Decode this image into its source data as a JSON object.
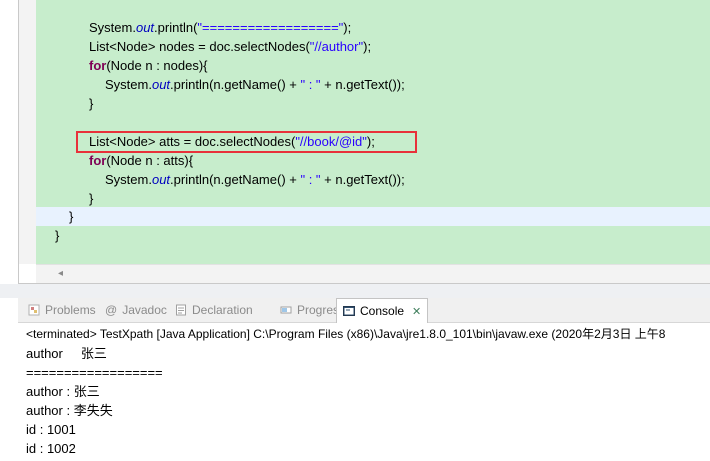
{
  "editor": {
    "lines": [
      {
        "parts": [
          {
            "t": "System."
          },
          {
            "t": "out",
            "c": "fld"
          },
          {
            "t": ".println("
          },
          {
            "t": "\"==================\"",
            "c": "str"
          },
          {
            "t": ");"
          }
        ]
      },
      {
        "parts": [
          {
            "t": "List<Node> nodes = doc.selectNodes("
          },
          {
            "t": "\"//author\"",
            "c": "str"
          },
          {
            "t": ");"
          }
        ]
      },
      {
        "parts": [
          {
            "t": "for",
            "c": "kw"
          },
          {
            "t": "(Node n : nodes){"
          }
        ]
      },
      {
        "parts": [
          {
            "t": "System."
          },
          {
            "t": "out",
            "c": "fld"
          },
          {
            "t": ".println(n.getName() + "
          },
          {
            "t": "\" : \"",
            "c": "str"
          },
          {
            "t": " + n.getText());"
          }
        ]
      },
      {
        "parts": [
          {
            "t": "}"
          }
        ]
      },
      {
        "parts": []
      },
      {
        "parts": [
          {
            "t": "List<Node> atts = doc.selectNodes("
          },
          {
            "t": "\"//book/@id\"",
            "c": "str"
          },
          {
            "t": ");"
          }
        ]
      },
      {
        "parts": [
          {
            "t": "for",
            "c": "kw"
          },
          {
            "t": "(Node n : atts){"
          }
        ]
      },
      {
        "parts": [
          {
            "t": "System."
          },
          {
            "t": "out",
            "c": "fld"
          },
          {
            "t": ".println(n.getName() + "
          },
          {
            "t": "\" : \"",
            "c": "str"
          },
          {
            "t": " + n.getText());"
          }
        ]
      },
      {
        "parts": [
          {
            "t": "}"
          }
        ]
      },
      {
        "parts": [
          {
            "t": "}"
          }
        ]
      },
      {
        "parts": [
          {
            "t": "}"
          }
        ]
      }
    ]
  },
  "views": {
    "tabs": [
      {
        "label": "Problems",
        "icon": "problems-icon",
        "active": false
      },
      {
        "label": "Javadoc",
        "icon": "at-icon",
        "active": false
      },
      {
        "label": "Declaration",
        "icon": "declaration-icon",
        "active": false
      },
      {
        "label": "Progress",
        "icon": "progress-icon",
        "active": false
      },
      {
        "label": "Console",
        "icon": "console-icon",
        "active": true
      }
    ],
    "close_symbol": "✕"
  },
  "console": {
    "header": "<terminated> TestXpath [Java Application] C:\\Program Files (x86)\\Java\\jre1.8.0_101\\bin\\javaw.exe (2020年2月3日 上午8",
    "output": [
      "author     张三",
      "==================",
      "author : 张三",
      "author : 李失失",
      "id : 1001",
      "id : 1002"
    ]
  },
  "colors": {
    "editor_bg": "#c7edcc",
    "highlight_box": "#e8313a",
    "keyword": "#7f0055",
    "string": "#2a00ff"
  }
}
